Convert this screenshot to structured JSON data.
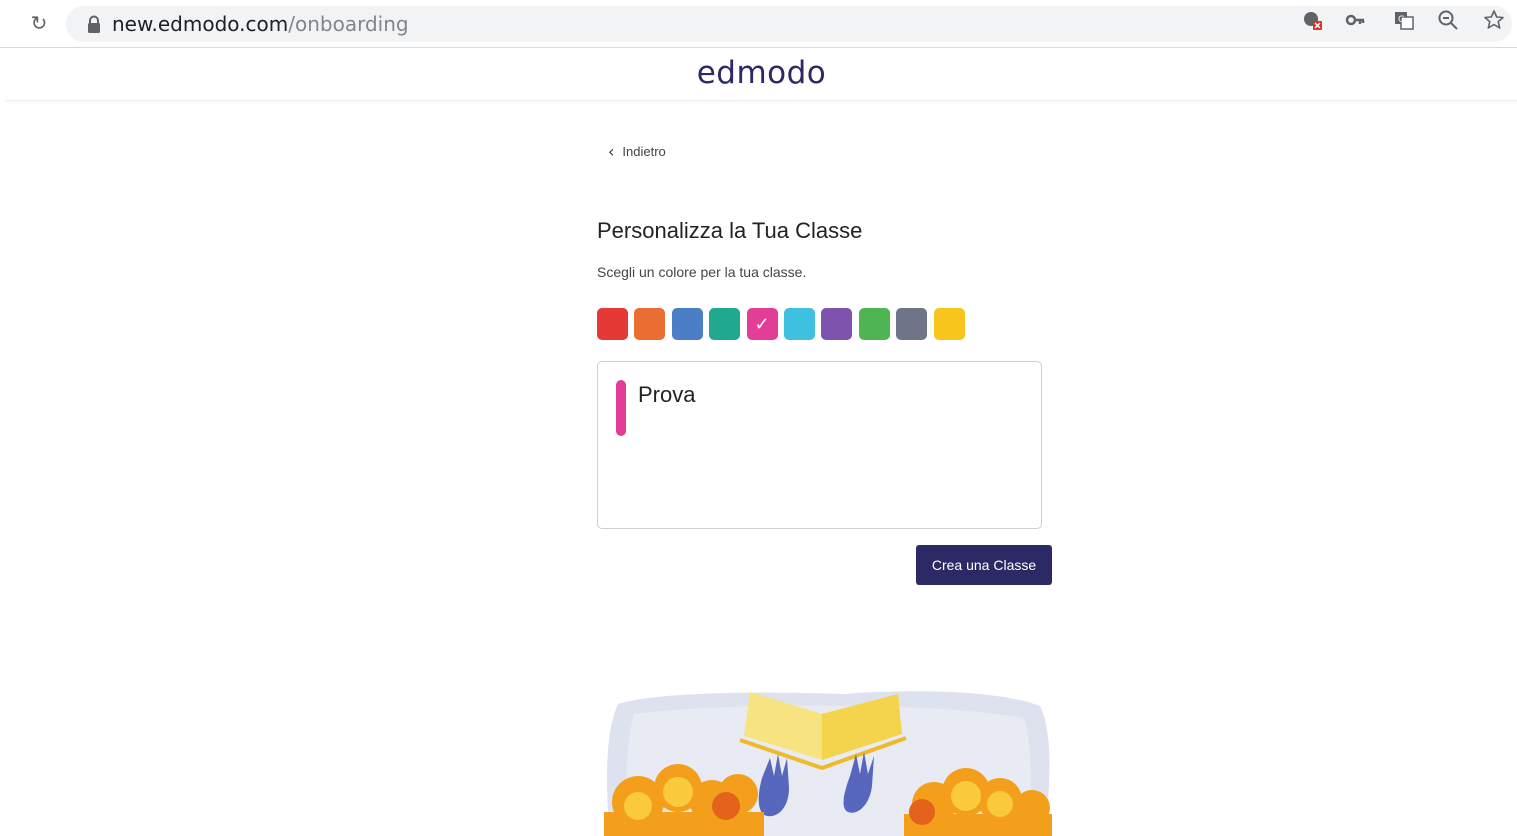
{
  "browser": {
    "url_host": "new.edmodo.com",
    "url_path": "/onboarding",
    "icons": [
      "reload-icon",
      "lock-icon",
      "blocked-cookie-icon",
      "key-icon",
      "translate-icon",
      "zoom-icon",
      "star-icon"
    ]
  },
  "header": {
    "logo_text": "edmodo"
  },
  "back": {
    "label": "Indietro"
  },
  "page": {
    "title": "Personalizza la Tua Classe",
    "subtitle": "Scegli un colore per la tua classe."
  },
  "colors": {
    "swatches": [
      {
        "name": "red",
        "hex": "#e53935",
        "selected": false
      },
      {
        "name": "orange",
        "hex": "#eb6f33",
        "selected": false
      },
      {
        "name": "blue",
        "hex": "#4a7fc8",
        "selected": false
      },
      {
        "name": "teal",
        "hex": "#20a98f",
        "selected": false
      },
      {
        "name": "pink",
        "hex": "#e33e97",
        "selected": true
      },
      {
        "name": "light-blue",
        "hex": "#3ec0e0",
        "selected": false
      },
      {
        "name": "purple",
        "hex": "#7d53ad",
        "selected": false
      },
      {
        "name": "green",
        "hex": "#4db552",
        "selected": false
      },
      {
        "name": "gray",
        "hex": "#6f7589",
        "selected": false
      },
      {
        "name": "yellow",
        "hex": "#f7c51b",
        "selected": false
      }
    ],
    "check_glyph": "✓",
    "brand": "#2b2a66"
  },
  "preview": {
    "class_name": "Prova",
    "accent": "#e33e97"
  },
  "actions": {
    "create_label": "Crea una Classe"
  }
}
